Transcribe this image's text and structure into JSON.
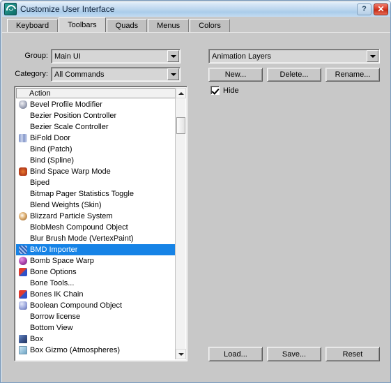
{
  "window": {
    "title": "Customize User Interface",
    "icon": "max-app-icon",
    "help_label": "?",
    "close_label": "✕"
  },
  "tabs": [
    {
      "label": "Keyboard",
      "selected": false
    },
    {
      "label": "Toolbars",
      "selected": true
    },
    {
      "label": "Quads",
      "selected": false
    },
    {
      "label": "Menus",
      "selected": false
    },
    {
      "label": "Colors",
      "selected": false
    }
  ],
  "left_panel": {
    "group_label": "Group:",
    "group_value": "Main UI",
    "category_label": "Category:",
    "category_value": "All Commands",
    "list_header": "Action",
    "items": [
      {
        "label": "Bevel Profile Modifier",
        "icon": "vase-icon",
        "icon_class": "ic-vase",
        "selected": false
      },
      {
        "label": "Bezier Position Controller",
        "icon": "none",
        "icon_class": "",
        "selected": false
      },
      {
        "label": "Bezier Scale Controller",
        "icon": "none",
        "icon_class": "",
        "selected": false
      },
      {
        "label": "BiFold Door",
        "icon": "door-icon",
        "icon_class": "ic-door",
        "selected": false
      },
      {
        "label": "Bind (Patch)",
        "icon": "none",
        "icon_class": "",
        "selected": false
      },
      {
        "label": "Bind (Spline)",
        "icon": "none",
        "icon_class": "",
        "selected": false
      },
      {
        "label": "Bind Space Warp Mode",
        "icon": "space-warp-icon",
        "icon_class": "ic-warp",
        "selected": false
      },
      {
        "label": "Biped",
        "icon": "none",
        "icon_class": "",
        "selected": false
      },
      {
        "label": "Bitmap Pager Statistics Toggle",
        "icon": "none",
        "icon_class": "",
        "selected": false
      },
      {
        "label": "Blend Weights (Skin)",
        "icon": "none",
        "icon_class": "",
        "selected": false
      },
      {
        "label": "Blizzard Particle System",
        "icon": "particle-icon",
        "icon_class": "ic-sparkle",
        "selected": false
      },
      {
        "label": "BlobMesh Compound Object",
        "icon": "none",
        "icon_class": "",
        "selected": false
      },
      {
        "label": "Blur Brush Mode (VertexPaint)",
        "icon": "none",
        "icon_class": "",
        "selected": false
      },
      {
        "label": "BMD Importer",
        "icon": "mesh-icon",
        "icon_class": "ic-mesh",
        "selected": true
      },
      {
        "label": "Bomb Space Warp",
        "icon": "bomb-icon",
        "icon_class": "ic-bomb",
        "selected": false
      },
      {
        "label": "Bone Options",
        "icon": "bone-icon",
        "icon_class": "ic-bone",
        "selected": false
      },
      {
        "label": "Bone Tools...",
        "icon": "none",
        "icon_class": "",
        "selected": false
      },
      {
        "label": "Bones IK Chain",
        "icon": "bone-icon",
        "icon_class": "ic-bone",
        "selected": false
      },
      {
        "label": "Boolean Compound Object",
        "icon": "boolean-icon",
        "icon_class": "ic-bool",
        "selected": false
      },
      {
        "label": "Borrow license",
        "icon": "none",
        "icon_class": "",
        "selected": false
      },
      {
        "label": "Bottom View",
        "icon": "none",
        "icon_class": "",
        "selected": false
      },
      {
        "label": "Box",
        "icon": "box-icon",
        "icon_class": "ic-box",
        "selected": false
      },
      {
        "label": "Box Gizmo (Atmospheres)",
        "icon": "box-gizmo-icon",
        "icon_class": "ic-boxgiz",
        "selected": false
      }
    ]
  },
  "right_panel": {
    "toolbar_select_value": "Animation Layers",
    "new_label": "New...",
    "delete_label": "Delete...",
    "rename_label": "Rename...",
    "hide_label": "Hide",
    "hide_checked": true,
    "load_label": "Load...",
    "save_label": "Save...",
    "reset_label": "Reset"
  },
  "colors": {
    "dialog_bg": "#c8c8c8",
    "selection": "#1683e6",
    "titlebar_start": "#eaf2fb",
    "titlebar_end": "#c3dcf2",
    "close_button": "#d83a25"
  }
}
